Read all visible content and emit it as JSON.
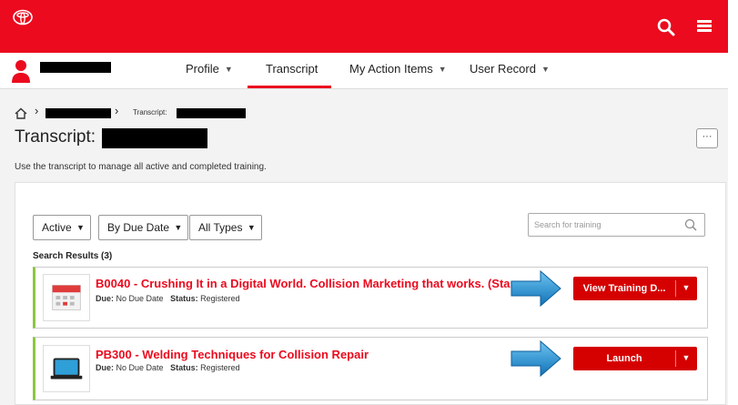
{
  "nav": {
    "items": [
      {
        "label": "Profile",
        "has_caret": true
      },
      {
        "label": "Transcript",
        "active": true
      },
      {
        "label": "My Action Items",
        "has_caret": true
      },
      {
        "label": "User Record",
        "has_caret": true
      }
    ]
  },
  "breadcrumb": {
    "current_label": "Transcript:"
  },
  "page": {
    "title": "Transcript:",
    "more_button": "···",
    "description": "Use the transcript to manage all active and completed training."
  },
  "filters": [
    {
      "label": "Active"
    },
    {
      "label": "By Due Date"
    },
    {
      "label": "All Types"
    }
  ],
  "search": {
    "placeholder": "Search for training"
  },
  "results": {
    "label": "Search Results (3)"
  },
  "trainings": [
    {
      "title": "B0040 - Crushing It in a Digital World. Collision Marketing that works. (Start",
      "due_label": "Due:",
      "due_value": "No Due Date",
      "status_label": "Status:",
      "status_value": "Registered",
      "action": "View Training D...",
      "icon": "calendar-icon"
    },
    {
      "title": "PB300 - Welding Techniques for Collision Repair",
      "due_label": "Due:",
      "due_value": "No Due Date",
      "status_label": "Status:",
      "status_value": "Registered",
      "action": "Launch",
      "icon": "laptop-icon"
    }
  ],
  "colors": {
    "brand_red": "#eb0a1e",
    "action_red": "#d50000",
    "active_border": "#8dc63f",
    "arrow_blue": "#1a8fd6"
  }
}
